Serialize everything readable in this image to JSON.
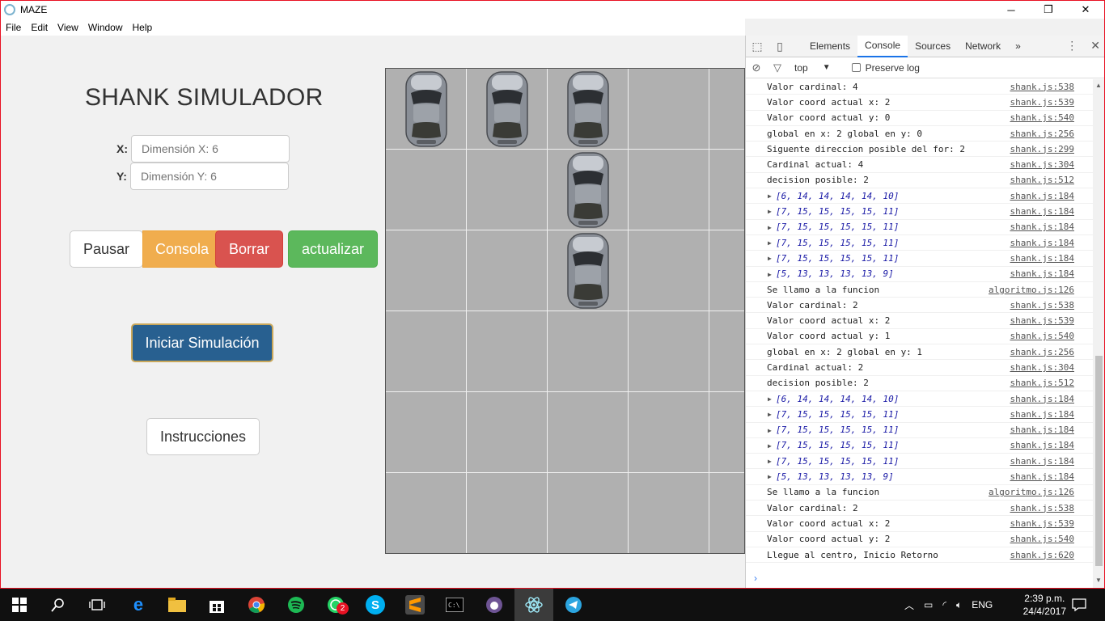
{
  "window": {
    "title": "MAZE",
    "minimize_glyph": "─",
    "maximize_glyph": "❐",
    "close_glyph": "✕"
  },
  "menu": [
    "File",
    "Edit",
    "View",
    "Window",
    "Help"
  ],
  "app": {
    "heading": "SHANK SIMULADOR",
    "x_label": "X:",
    "y_label": "Y:",
    "x_placeholder": "Dimensión X: 6",
    "y_placeholder": "Dimensión Y: 6",
    "buttons": {
      "pause": "Pausar",
      "console": "Consola",
      "clear": "Borrar",
      "update": "actualizar",
      "start": "Iniciar Simulación",
      "instructions": "Instrucciones"
    },
    "grid": {
      "rows": 6,
      "cols": 5,
      "cars": [
        [
          0,
          0
        ],
        [
          0,
          1
        ],
        [
          0,
          2
        ],
        [
          1,
          2
        ],
        [
          2,
          2
        ]
      ]
    }
  },
  "devtools": {
    "tabs": [
      "Elements",
      "Console",
      "Sources",
      "Network"
    ],
    "active_tab": "Console",
    "more_tabs": "»",
    "menu_glyph": "⋮",
    "close_glyph": "✕",
    "context": "top",
    "context_arrow": "▼",
    "preserve_log": "Preserve log",
    "prompt": "›",
    "logs": [
      {
        "text": "Valor cardinal: 4",
        "src": "shank.js:538"
      },
      {
        "text": "Valor coord actual x: 2",
        "src": "shank.js:539"
      },
      {
        "text": "Valor coord actual y: 0",
        "src": "shank.js:540"
      },
      {
        "text": "global en x: 2 global en y: 0",
        "src": "shank.js:256"
      },
      {
        "text": "Siguente direccion posible del for: 2",
        "src": "shank.js:299"
      },
      {
        "text": "Cardinal actual: 4",
        "src": "shank.js:304"
      },
      {
        "text": "decision posible: 2",
        "src": "shank.js:512"
      },
      {
        "text": "[6, 14, 14, 14, 14, 10]",
        "src": "shank.js:184",
        "array": true
      },
      {
        "text": "[7, 15, 15, 15, 15, 11]",
        "src": "shank.js:184",
        "array": true
      },
      {
        "text": "[7, 15, 15, 15, 15, 11]",
        "src": "shank.js:184",
        "array": true
      },
      {
        "text": "[7, 15, 15, 15, 15, 11]",
        "src": "shank.js:184",
        "array": true
      },
      {
        "text": "[7, 15, 15, 15, 15, 11]",
        "src": "shank.js:184",
        "array": true
      },
      {
        "text": "[5, 13, 13, 13, 13, 9]",
        "src": "shank.js:184",
        "array": true
      },
      {
        "text": "Se llamo a la funcion",
        "src": "algoritmo.js:126"
      },
      {
        "text": "Valor cardinal: 2",
        "src": "shank.js:538"
      },
      {
        "text": "Valor coord actual x: 2",
        "src": "shank.js:539"
      },
      {
        "text": "Valor coord actual y: 1",
        "src": "shank.js:540"
      },
      {
        "text": "global en x: 2 global en y: 1",
        "src": "shank.js:256"
      },
      {
        "text": "Cardinal actual: 2",
        "src": "shank.js:304"
      },
      {
        "text": "decision posible: 2",
        "src": "shank.js:512"
      },
      {
        "text": "[6, 14, 14, 14, 14, 10]",
        "src": "shank.js:184",
        "array": true
      },
      {
        "text": "[7, 15, 15, 15, 15, 11]",
        "src": "shank.js:184",
        "array": true
      },
      {
        "text": "[7, 15, 15, 15, 15, 11]",
        "src": "shank.js:184",
        "array": true
      },
      {
        "text": "[7, 15, 15, 15, 15, 11]",
        "src": "shank.js:184",
        "array": true
      },
      {
        "text": "[7, 15, 15, 15, 15, 11]",
        "src": "shank.js:184",
        "array": true
      },
      {
        "text": "[5, 13, 13, 13, 13, 9]",
        "src": "shank.js:184",
        "array": true
      },
      {
        "text": "Se llamo a la funcion",
        "src": "algoritmo.js:126"
      },
      {
        "text": "Valor cardinal: 2",
        "src": "shank.js:538"
      },
      {
        "text": "Valor coord actual x: 2",
        "src": "shank.js:539"
      },
      {
        "text": "Valor coord actual y: 2",
        "src": "shank.js:540"
      },
      {
        "text": "Llegue al centro, Inicio Retorno",
        "src": "shank.js:620"
      }
    ]
  },
  "taskbar": {
    "language": "ENG",
    "time": "2:39 p.m.",
    "date": "24/4/2017",
    "whatsapp_badge": "2",
    "icons": [
      "windows-start-icon",
      "search-icon",
      "task-view-icon",
      "edge-icon",
      "file-explorer-icon",
      "store-icon",
      "chrome-icon",
      "spotify-icon",
      "whatsapp-icon",
      "skype-icon",
      "sublime-icon",
      "cmd-icon",
      "github-icon",
      "electron-icon",
      "telegram-icon"
    ]
  },
  "colors": {
    "primary": "#286090",
    "warning": "#f0ad4e",
    "danger": "#d9534f",
    "success": "#5cb85c",
    "cell": "#b0b0b0"
  }
}
